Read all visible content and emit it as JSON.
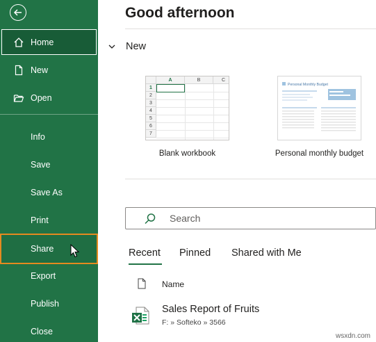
{
  "sidebar": {
    "items": [
      {
        "label": "Home",
        "icon": "home-icon"
      },
      {
        "label": "New",
        "icon": "new-document-icon"
      },
      {
        "label": "Open",
        "icon": "folder-open-icon"
      },
      {
        "label": "Info"
      },
      {
        "label": "Save"
      },
      {
        "label": "Save As"
      },
      {
        "label": "Print"
      },
      {
        "label": "Share"
      },
      {
        "label": "Export"
      },
      {
        "label": "Publish"
      },
      {
        "label": "Close"
      }
    ],
    "background_color": "#217346",
    "highlight_color": "#e58a1f"
  },
  "main": {
    "greeting": "Good afternoon",
    "new_section": "New",
    "templates": [
      {
        "label": "Blank workbook",
        "columns": [
          "A",
          "B",
          "C"
        ],
        "rows": [
          "1",
          "2",
          "3",
          "4",
          "5",
          "6",
          "7"
        ]
      },
      {
        "label": "Personal monthly budget",
        "thumb_title": "Personal Monthly Budget"
      }
    ],
    "search_placeholder": "Search",
    "tabs": [
      {
        "label": "Recent"
      },
      {
        "label": "Pinned"
      },
      {
        "label": "Shared with Me"
      }
    ],
    "list_header": "Name",
    "files": [
      {
        "name": "Sales Report of Fruits",
        "path": "F: » Softeko » 3566"
      }
    ]
  },
  "watermark": "wsxdn.com"
}
